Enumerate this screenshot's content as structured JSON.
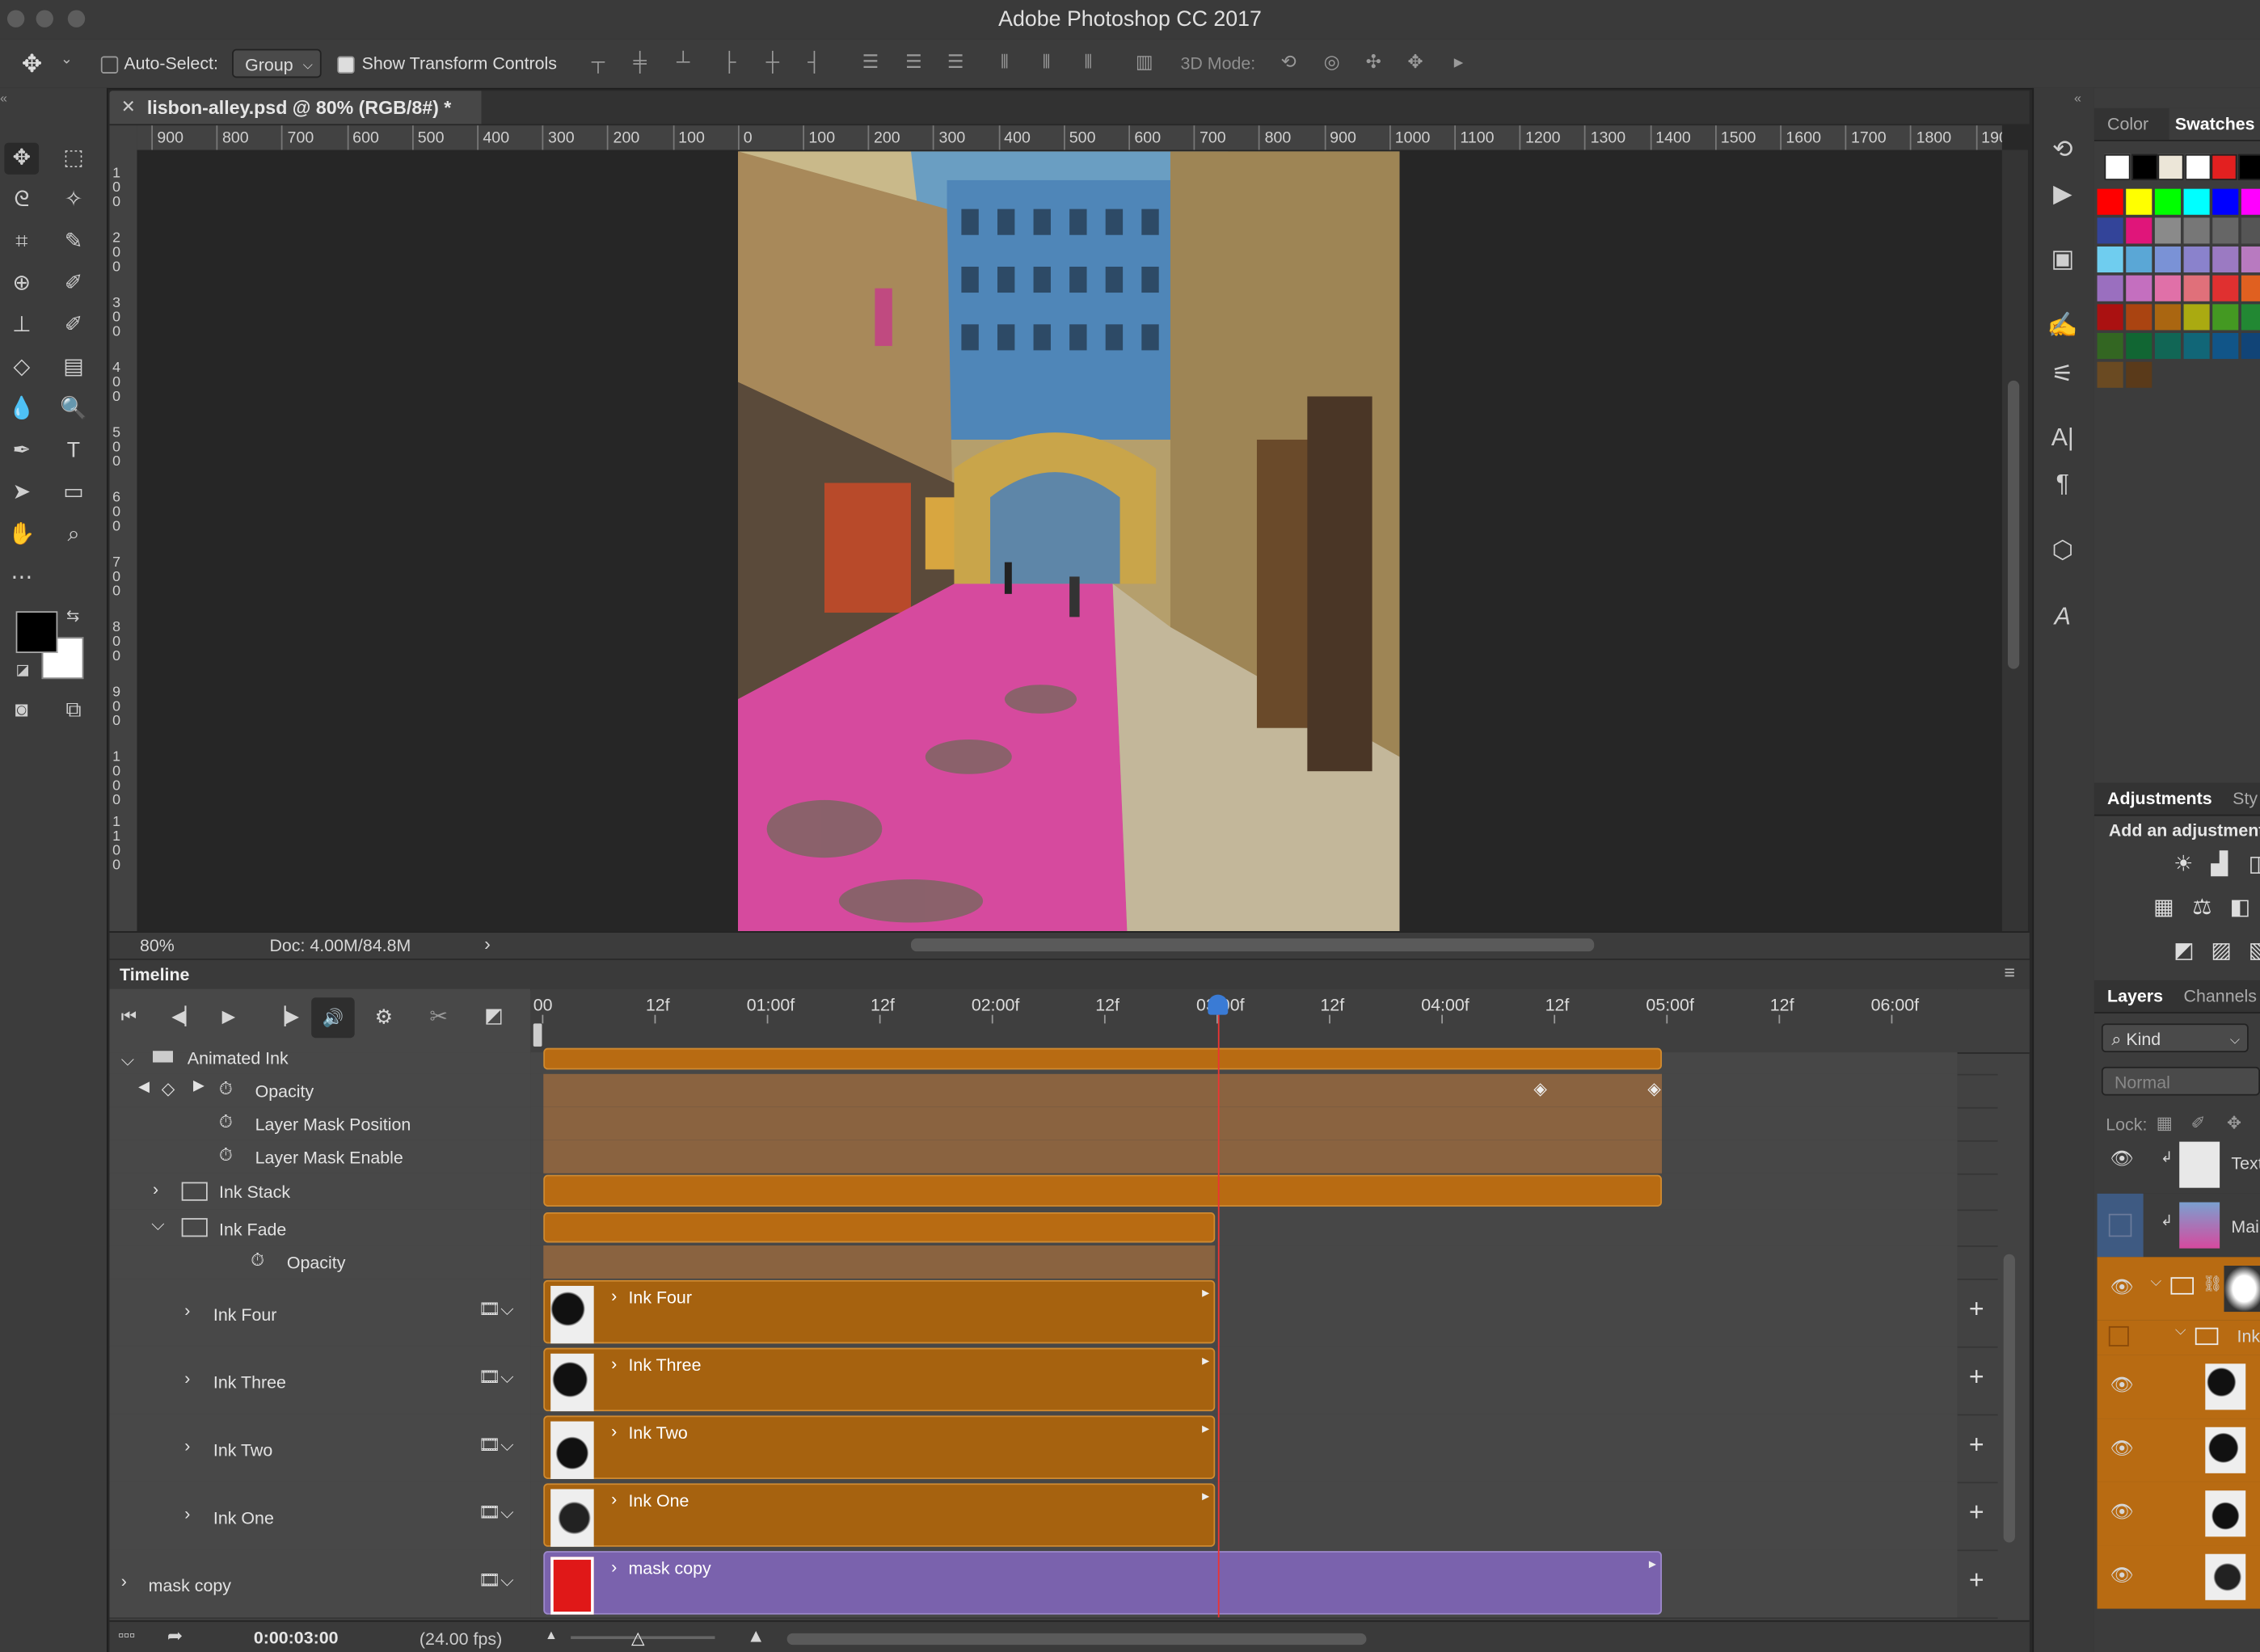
{
  "app": {
    "window_title": "Adobe Photoshop CC 2017"
  },
  "options_bar": {
    "auto_select_label": "Auto-Select:",
    "auto_select_value": "Group",
    "show_transform_label": "Show Transform Controls",
    "mode_3d_label": "3D Mode:"
  },
  "document": {
    "tab_title": "lisbon-alley.psd @ 80% (RGB/8#) *",
    "zoom": "80%",
    "doc_size": "Doc: 4.00M/84.8M",
    "ruler_h": [
      "900",
      "800",
      "700",
      "600",
      "500",
      "400",
      "300",
      "200",
      "100",
      "0",
      "100",
      "200",
      "300",
      "400",
      "500",
      "600",
      "700",
      "800",
      "900",
      "1000",
      "1100",
      "1200",
      "1300",
      "1400",
      "1500",
      "1600",
      "1700",
      "1800",
      "190"
    ],
    "ruler_v": [
      "100",
      "200",
      "300",
      "400",
      "500",
      "600",
      "700",
      "800",
      "900",
      "1000",
      "1100"
    ]
  },
  "timeline": {
    "title": "Timeline",
    "ruler_labels": [
      "00",
      "12f",
      "01:00f",
      "12f",
      "02:00f",
      "12f",
      "03:00f",
      "12f",
      "04:00f",
      "12f",
      "05:00f",
      "12f",
      "06:00f"
    ],
    "current_time": "0:00:03:00",
    "fps": "(24.00 fps)",
    "playhead_seconds": 3,
    "rows": {
      "animated_ink": "Animated Ink",
      "opacity": "Opacity",
      "layer_mask_position": "Layer Mask Position",
      "layer_mask_enable": "Layer Mask Enable",
      "ink_stack": "Ink Stack",
      "ink_fade": "Ink Fade",
      "fade_opacity": "Opacity",
      "ink_four": "Ink Four",
      "ink_three": "Ink Three",
      "ink_two": "Ink Two",
      "ink_one": "Ink One",
      "mask_copy": "mask copy"
    }
  },
  "panels": {
    "color_tab": "Color",
    "swatches_tab": "Swatches",
    "adjustments_tab": "Adjustments",
    "styles_tab": "Sty",
    "add_adjustment": "Add an adjustment",
    "layers_tab": "Layers",
    "channels_tab": "Channels",
    "kind_filter": "Kind",
    "blend_mode": "Normal",
    "lock_label": "Lock:",
    "layer_names": [
      "Text",
      "Mai",
      "",
      "Ink",
      "",
      "",
      "",
      ""
    ]
  },
  "colors": {
    "clip_orange": "#b86b12",
    "clip_purple": "#7a62ad",
    "playhead": "#e33333",
    "swatches_row1": [
      "#ffffff",
      "#000000",
      "#ece6d8",
      "#ffffff",
      "#e32020",
      "#000000"
    ],
    "swatches_grid": [
      [
        "#ff0000",
        "#ffff00",
        "#00ff00",
        "#00ffff",
        "#0000ff",
        "#ff00ff"
      ],
      [
        "#334499",
        "#e0157a",
        "#8a8a8a",
        "#777777",
        "#666666",
        "#555555"
      ],
      [
        "#6fcdef",
        "#5aa7d6",
        "#7a92d6",
        "#8a82cc",
        "#9b7ac2",
        "#b87ac0"
      ],
      [
        "#9a6fbf",
        "#c46fbf",
        "#e070a8",
        "#e0707a",
        "#e03030",
        "#e06020"
      ],
      [
        "#aa1111",
        "#aa4411",
        "#aa6611",
        "#aaaa11",
        "#449922",
        "#228833"
      ],
      [
        "#336622",
        "#116633",
        "#116655",
        "#116677",
        "#115588",
        "#114477"
      ],
      [
        "#6a4a22",
        "#5a3a1a"
      ]
    ]
  }
}
